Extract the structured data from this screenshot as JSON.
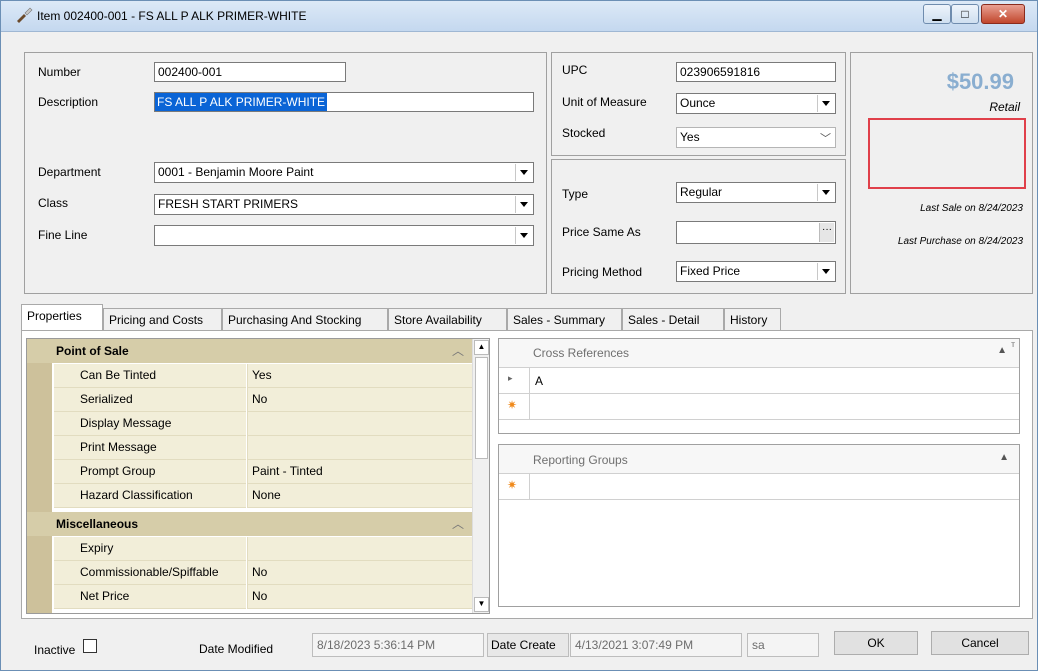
{
  "window": {
    "title": "Item 002400-001 - FS ALL P ALK PRIMER-WHITE",
    "minimize_icon": "minimize-icon",
    "maximize_icon": "maximize-icon",
    "close_icon": "close-icon"
  },
  "item": {
    "number_label": "Number",
    "number_value": "002400-001",
    "description_label": "Description",
    "description_value": "FS ALL P ALK PRIMER-WHITE",
    "department_label": "Department",
    "department_value": "0001 - Benjamin Moore Paint",
    "class_label": "Class",
    "class_value": "FRESH START PRIMERS",
    "fine_line_label": "Fine Line",
    "fine_line_value": ""
  },
  "details": {
    "upc_label": "UPC",
    "upc_value": "023906591816",
    "uom_label": "Unit of Measure",
    "uom_value": "Ounce",
    "stocked_label": "Stocked",
    "stocked_value": "Yes",
    "type_label": "Type",
    "type_value": "Regular",
    "price_same_as_label": "Price Same As",
    "price_same_as_value": "",
    "pricing_method_label": "Pricing Method",
    "pricing_method_value": "Fixed Price"
  },
  "pricing": {
    "price": "$50.99",
    "price_caption": "Retail",
    "last_sale": "Last Sale on 8/24/2023",
    "last_purchase": "Last Purchase on 8/24/2023",
    "highlight_color": "#e0404a"
  },
  "tabs": [
    "Properties",
    "Pricing and Costs",
    "Purchasing And Stocking",
    "Store Availability",
    "Sales - Summary",
    "Sales - Detail",
    "History"
  ],
  "properties": {
    "pos_category": "Point of Sale",
    "misc_category": "Miscellaneous",
    "rows": [
      {
        "name": "Can Be Tinted",
        "value": "Yes"
      },
      {
        "name": "Serialized",
        "value": "No"
      },
      {
        "name": "Display Message",
        "value": ""
      },
      {
        "name": "Print Message",
        "value": ""
      },
      {
        "name": "Prompt Group",
        "value": "Paint - Tinted"
      },
      {
        "name": "Hazard Classification",
        "value": "None"
      }
    ],
    "misc_rows": [
      {
        "name": "Expiry",
        "value": ""
      },
      {
        "name": "Commissionable/Spiffable",
        "value": "No"
      },
      {
        "name": "Net Price",
        "value": "No"
      }
    ]
  },
  "cross_references": {
    "header": "Cross References",
    "rows": [
      "A"
    ]
  },
  "reporting_groups": {
    "header": "Reporting Groups"
  },
  "footer": {
    "inactive_label": "Inactive",
    "date_modified_label": "Date Modified",
    "date_modified_value": "8/18/2023 5:36:14 PM",
    "date_create_label": "Date Create",
    "date_create_value": "4/13/2021 3:07:49 PM",
    "user_value": "sa",
    "ok_label": "OK",
    "cancel_label": "Cancel"
  }
}
